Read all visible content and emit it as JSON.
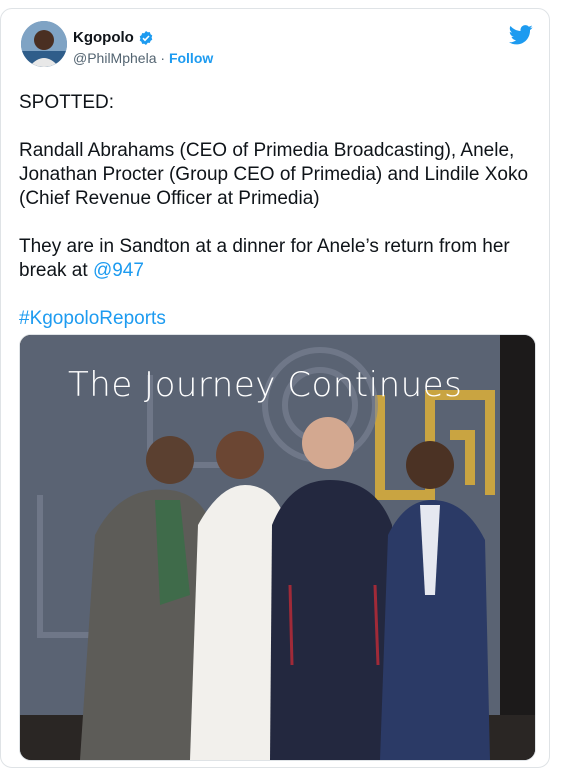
{
  "author": {
    "display_name": "Kgopolo",
    "handle": "@PhilMphela",
    "separator": "·",
    "follow_label": "Follow"
  },
  "tweet": {
    "line1": "SPOTTED:",
    "line2": "Randall Abrahams (CEO of Primedia Broadcasting), Anele, Jonathan Procter (Group CEO of Primedia) and Lindile Xoko (Chief Revenue Officer at Primedia)",
    "line3_text": "They are in Sandton at a dinner for Anele’s return from her break at ",
    "line3_mention": "@947",
    "hashtag": "#KgopoloReports"
  },
  "photo": {
    "banner_text": "The Journey Continues"
  },
  "colors": {
    "accent": "#1d9bf0",
    "text": "#0f1419",
    "muted": "#536471"
  },
  "icons": [
    "verified-badge-icon",
    "twitter-bird-icon"
  ]
}
